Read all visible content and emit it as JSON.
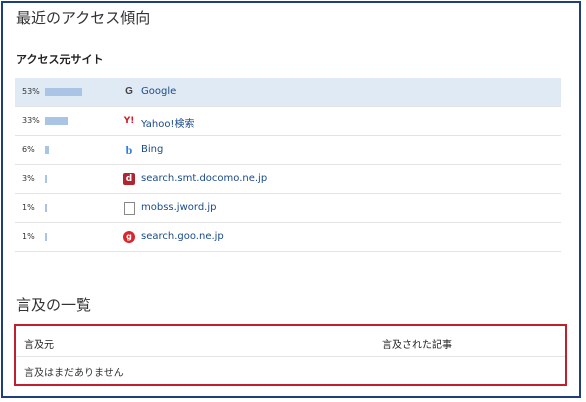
{
  "access": {
    "title": "最近のアクセス傾向",
    "sources_heading": "アクセス元サイト",
    "sites": [
      {
        "percent": "53%",
        "ratio": 0.53,
        "icon": "google-icon",
        "glyph": "G",
        "name": "Google",
        "highlighted": true
      },
      {
        "percent": "33%",
        "ratio": 0.33,
        "icon": "yahoo-icon",
        "glyph": "Y!",
        "name": "Yahoo!検索",
        "highlighted": false
      },
      {
        "percent": "6%",
        "ratio": 0.06,
        "icon": "bing-icon",
        "glyph": "b",
        "name": "Bing",
        "highlighted": false
      },
      {
        "percent": "3%",
        "ratio": 0.03,
        "icon": "docomo-icon",
        "glyph": "d",
        "name": "search.smt.docomo.ne.jp",
        "highlighted": false
      },
      {
        "percent": "1%",
        "ratio": 0.01,
        "icon": "document-icon",
        "glyph": "",
        "name": "mobss.jword.jp",
        "highlighted": false
      },
      {
        "percent": "1%",
        "ratio": 0.01,
        "icon": "goo-icon",
        "glyph": "g",
        "name": "search.goo.ne.jp",
        "highlighted": false
      }
    ]
  },
  "mentions": {
    "title": "言及の一覧",
    "col_source": "言及元",
    "col_article": "言及された記事",
    "empty_message": "言及はまだありません"
  },
  "colors": {
    "bar": "#a9c4e4",
    "highlight_row": "#dfeaf4",
    "frame_border": "#1f3f7a",
    "mentions_border": "#c0202c",
    "link": "#1a4a8a"
  }
}
